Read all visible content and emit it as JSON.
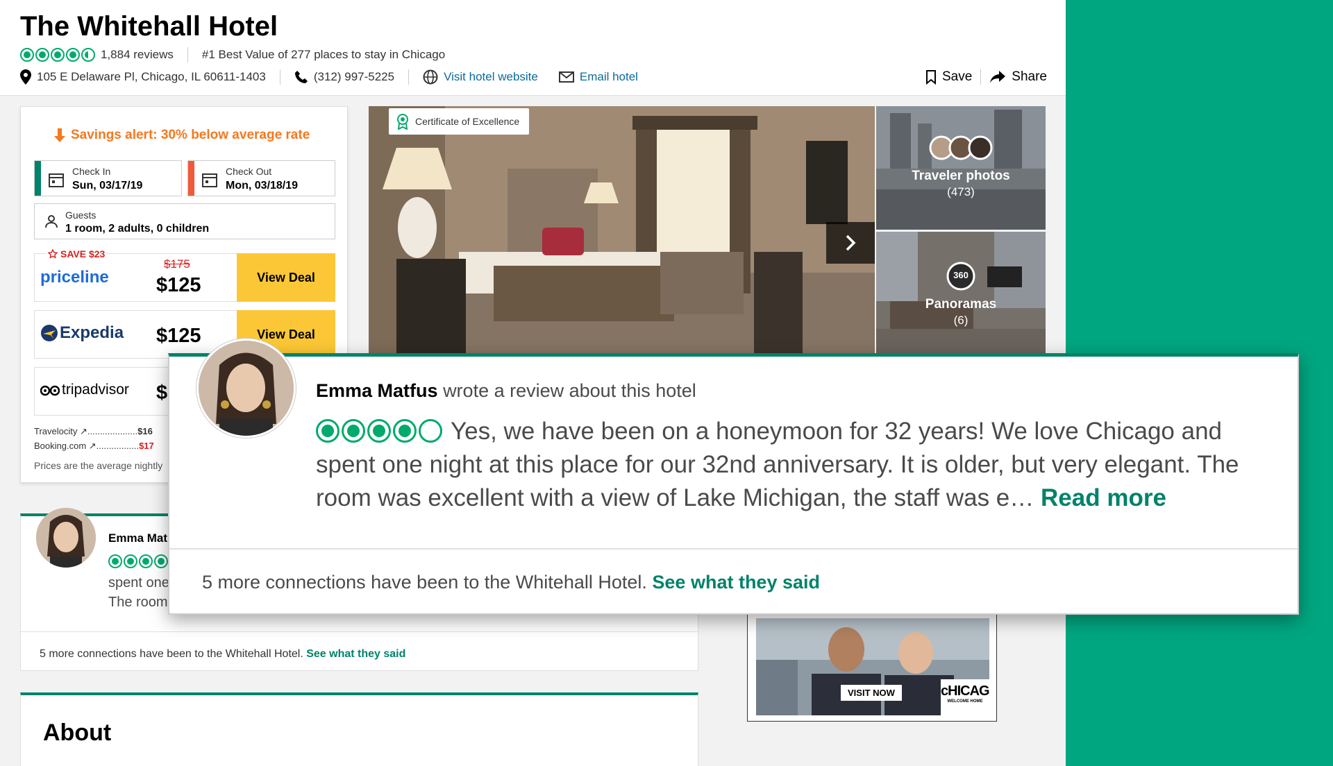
{
  "hotel": {
    "title": "The Whitehall Hotel",
    "reviews": "1,884 reviews",
    "ranking": "#1 Best Value of 277 places to stay in Chicago",
    "address": "105 E Delaware Pl, Chicago, IL 60611-1403",
    "phone": "(312) 997-5225",
    "website_label": "Visit hotel website",
    "email_label": "Email hotel",
    "rating": 4.5
  },
  "actions": {
    "save": "Save",
    "share": "Share"
  },
  "booking": {
    "savings_alert": "Savings alert: 30% below average rate",
    "check_in_label": "Check In",
    "check_in_value": "Sun, 03/17/19",
    "check_out_label": "Check Out",
    "check_out_value": "Mon, 03/18/19",
    "guests_label": "Guests",
    "guests_value": "1 room, 2 adults, 0 children",
    "save_badge": "SAVE $23",
    "deals": [
      {
        "provider": "priceline",
        "old_price": "$175",
        "price": "$125",
        "button": "View Deal"
      },
      {
        "provider": "Expedia",
        "price": "$125",
        "button": "View Deal"
      },
      {
        "provider": "tripadvisor",
        "price": "$"
      }
    ],
    "other_sites": [
      {
        "name": "Travelocity ↗",
        "dots": "....................",
        "price": "$16"
      },
      {
        "name": "Booking.com ↗",
        "dots": ".................",
        "price": "$17"
      }
    ],
    "note": "Prices are the average nightly"
  },
  "photos": {
    "certificate": "Certificate of Excellence",
    "traveler_label": "Traveler photos",
    "traveler_count": "(473)",
    "panorama_badge": "360",
    "panorama_label": "Panoramas",
    "panorama_count": "(6)"
  },
  "review_card": {
    "name": "Emma Mat",
    "line1": "spent one",
    "line2": "The room",
    "footer": "5 more connections have been to the Whitehall Hotel.",
    "footer_link": "See what they said"
  },
  "about": {
    "heading": "About"
  },
  "ad": {
    "button": "VISIT NOW",
    "brand": "cHICAGo",
    "tagline": "WELCOME HOME"
  },
  "overlay": {
    "name": "Emma Matfus",
    "action": "wrote a review about this hotel",
    "rating": 4,
    "text": "Yes, we have been on a honeymoon for 32 years! We love Chicago and spent one night at this place for our 32nd anniversary. It is older, but very elegant. The room was excellent with a view of Lake Michigan, the staff was e…",
    "read_more": "Read more",
    "footer": "5 more connections have been to the Whitehall Hotel.",
    "footer_link": "See what they said"
  },
  "colors": {
    "brand_green": "#00a680",
    "link_green": "#00826a",
    "bubble_green": "#00aa6c",
    "deal_button": "#fcc736",
    "savings_orange": "#f5781e",
    "save_red": "#d81e1e"
  }
}
